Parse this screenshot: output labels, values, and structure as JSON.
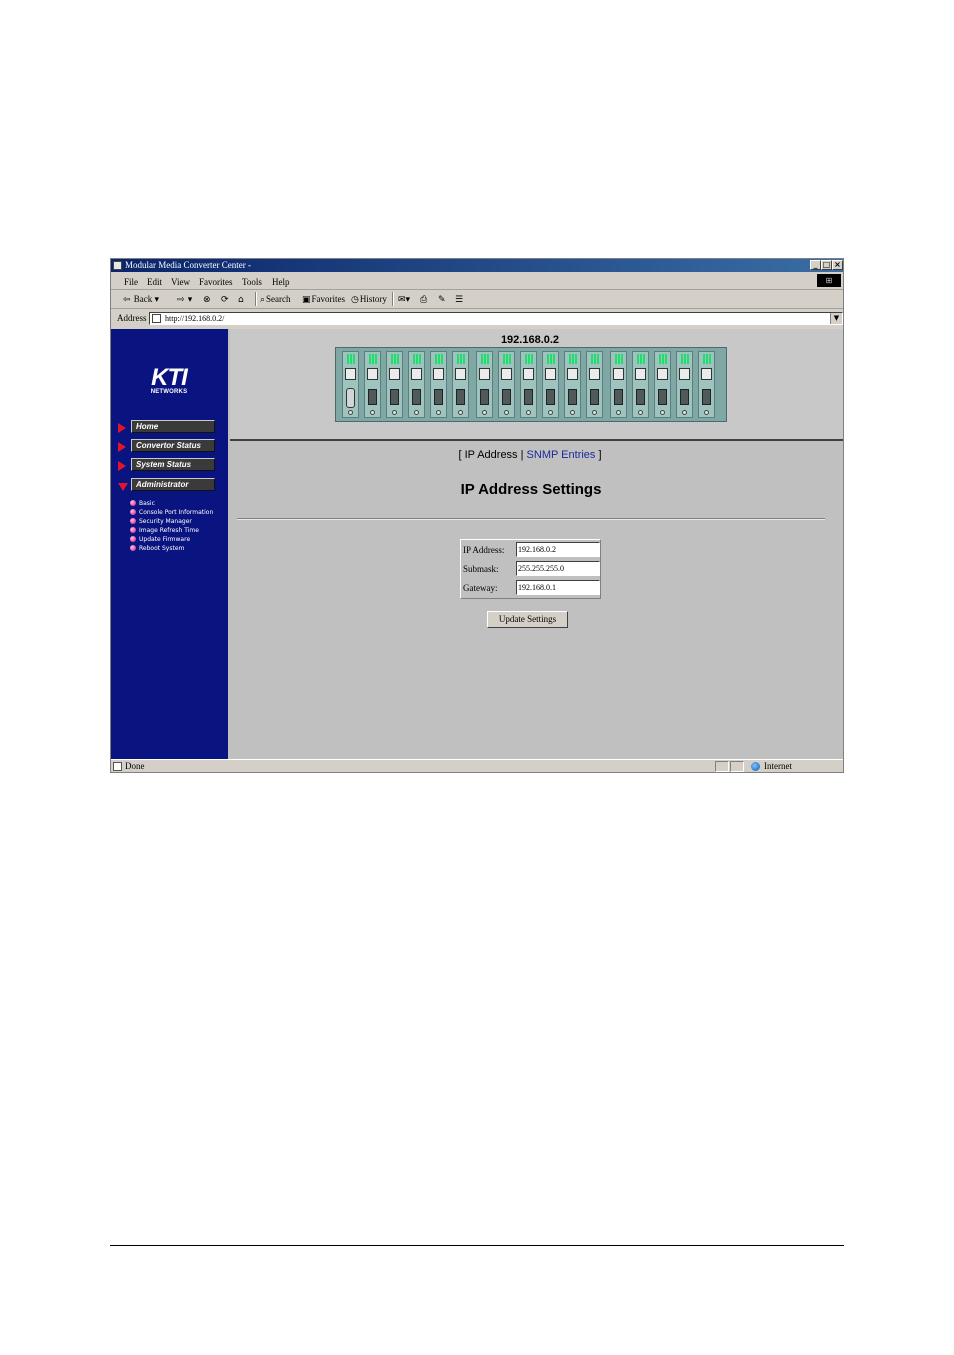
{
  "window": {
    "title": "Modular Media Converter Center -",
    "controls": [
      "_",
      "□",
      "×"
    ]
  },
  "menu": {
    "file": "File",
    "edit": "Edit",
    "view": "View",
    "favorites": "Favorites",
    "tools": "Tools",
    "help": "Help"
  },
  "toolbar": {
    "back": "Back",
    "search": "Search",
    "favorites": "Favorites",
    "history": "History"
  },
  "address": {
    "label": "Address",
    "url": "http://192.168.0.2/"
  },
  "sidebar": {
    "logo_big": "KTI",
    "logo_small": "NETWORKS",
    "nav": [
      {
        "label": "Home"
      },
      {
        "label": "Convertor Status"
      },
      {
        "label": "System Status"
      },
      {
        "label": "Administrator"
      }
    ],
    "submenu": [
      {
        "label": "Basic"
      },
      {
        "label": "Console Port Information"
      },
      {
        "label": "Security Manager"
      },
      {
        "label": "Image Refresh Time"
      },
      {
        "label": "Update Firmware"
      },
      {
        "label": "Reboot System"
      }
    ]
  },
  "device": {
    "ip_heading": "192.168.0.2",
    "slots": 17
  },
  "tabs": {
    "open_bracket": "[",
    "current": "IP Address",
    "separator": "|",
    "link": "SNMP Entries",
    "close_bracket": "]"
  },
  "page_title": "IP Address Settings",
  "form": {
    "ip_label": "IP Address:",
    "ip_value": "192.168.0.2",
    "submask_label": "Submask:",
    "submask_value": "255.255.255.0",
    "gateway_label": "Gateway:",
    "gateway_value": "192.168.0.1",
    "submit": "Update Settings"
  },
  "status": {
    "text": "Done",
    "zone": "Internet"
  },
  "colors": {
    "sidebar_bg": "#0a1480",
    "nav_arrow": "#e0142c",
    "link": "#1a2a9c",
    "led_green": "#1ee06a"
  }
}
